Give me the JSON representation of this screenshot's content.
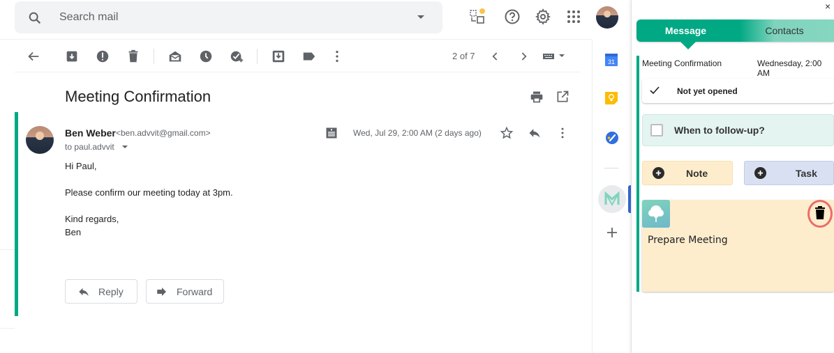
{
  "search": {
    "placeholder": "Search mail"
  },
  "top_icons": [
    "snip-notification-icon",
    "help-icon",
    "settings-gear-icon",
    "apps-grid-icon",
    "account-avatar"
  ],
  "toolbar": {
    "icons": [
      "back-arrow-icon",
      "archive-icon",
      "report-spam-icon",
      "delete-icon",
      "mark-unread-icon",
      "snooze-clock-icon",
      "add-task-icon",
      "move-to-icon",
      "label-icon",
      "more-vert-icon"
    ],
    "pager": "2 of 7",
    "input_tools": "keyboard-icon"
  },
  "message": {
    "subject": "Meeting Confirmation",
    "sender_name": "Ben Weber",
    "sender_email": "<ben.advvit@gmail.com>",
    "to": "to paul.advvit",
    "date": "Wed, Jul 29, 2:00 AM (2 days ago)",
    "body": [
      "Hi Paul,",
      "Please confirm our meeting today at 3pm.",
      "Kind regards,",
      "Ben"
    ],
    "reply_label": "Reply",
    "forward_label": "Forward"
  },
  "side_apps": [
    "calendar-icon",
    "keep-icon",
    "tasks-icon",
    "mailtrack-m-icon",
    "add-addon-icon"
  ],
  "panel": {
    "close": "×",
    "tabs": [
      {
        "label": "Message",
        "active": true
      },
      {
        "label": "Contacts",
        "active": false
      }
    ],
    "subject": "Meeting Confirmation",
    "date": "Wednesday, 2:00 AM",
    "status": "Not yet opened",
    "followup": "When to follow-up?",
    "note_label": "Note",
    "task_label": "Task",
    "note_text": "Prepare Meeting",
    "colors": {
      "accent": "#00a884",
      "note_bg": "#feedcd",
      "task_bg": "#d8e0f2",
      "highlight_ring": "#ec6b6b"
    }
  }
}
